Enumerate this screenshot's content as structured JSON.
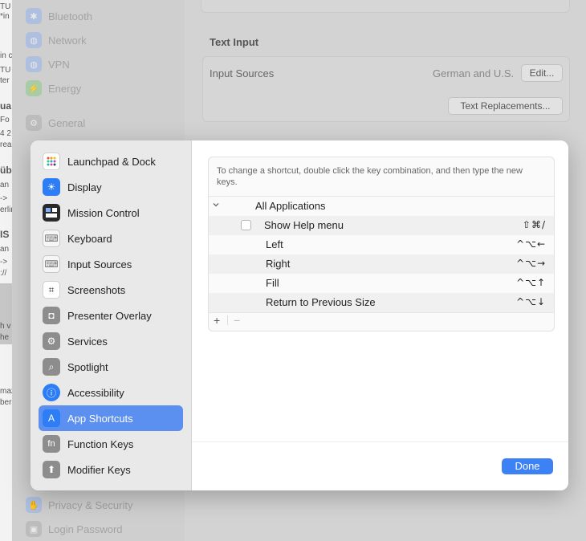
{
  "background": {
    "left_fragments": [
      "TU",
      "*in",
      "in c",
      "TU",
      "ter",
      "ua",
      "Fo",
      "4 2",
      "rea",
      "üb",
      "an",
      "->",
      "erlin",
      "IS",
      "an",
      "->",
      "://",
      "h v",
      "he",
      "maz",
      "bers"
    ],
    "sidebar_items": [
      {
        "label": "Bluetooth",
        "icon": "bluetooth-icon",
        "color": "#8aa7e0"
      },
      {
        "label": "Network",
        "icon": "globe-icon",
        "color": "#8aa7e0"
      },
      {
        "label": "VPN",
        "icon": "globe-icon",
        "color": "#8aa7e0"
      },
      {
        "label": "Energy",
        "icon": "energy-icon",
        "color": "#8cc08a"
      },
      {
        "label": "General",
        "icon": "gear-icon",
        "color": "#aaaaaa"
      },
      {
        "label": "Privacy & Security",
        "icon": "hand-icon",
        "color": "#8aa7e0"
      },
      {
        "label": "Login Password",
        "icon": "lock-icon",
        "color": "#aaaaaa"
      }
    ],
    "text_input_heading": "Text Input",
    "input_sources_label": "Input Sources",
    "input_sources_value": "German and U.S.",
    "edit_button": "Edit...",
    "text_replacements_button": "Text Replacements..."
  },
  "modal": {
    "sidebar": [
      {
        "label": "Launchpad & Dock",
        "icon": "launchpad-icon",
        "selected": false
      },
      {
        "label": "Display",
        "icon": "display-icon",
        "selected": false
      },
      {
        "label": "Mission Control",
        "icon": "mission-control-icon",
        "selected": false
      },
      {
        "label": "Keyboard",
        "icon": "keyboard-icon",
        "selected": false
      },
      {
        "label": "Input Sources",
        "icon": "input-sources-icon",
        "selected": false
      },
      {
        "label": "Screenshots",
        "icon": "screenshot-icon",
        "selected": false
      },
      {
        "label": "Presenter Overlay",
        "icon": "presenter-icon",
        "selected": false
      },
      {
        "label": "Services",
        "icon": "services-icon",
        "selected": false
      },
      {
        "label": "Spotlight",
        "icon": "spotlight-icon",
        "selected": false
      },
      {
        "label": "Accessibility",
        "icon": "accessibility-icon",
        "selected": false
      },
      {
        "label": "App Shortcuts",
        "icon": "app-store-icon",
        "selected": true
      },
      {
        "label": "Function Keys",
        "icon": "fn-icon",
        "selected": false
      },
      {
        "label": "Modifier Keys",
        "icon": "arrow-up-icon",
        "selected": false
      }
    ],
    "instructions": "To change a shortcut, double click the key combination, and then type the new keys.",
    "group_label": "All Applications",
    "shortcuts": [
      {
        "label": "Show Help menu",
        "keys": "⇧⌘/",
        "checkbox": true
      },
      {
        "label": "Left",
        "keys": "^⌥←",
        "checkbox": false
      },
      {
        "label": "Right",
        "keys": "^⌥→",
        "checkbox": false
      },
      {
        "label": "Fill",
        "keys": "^⌥↑",
        "checkbox": false
      },
      {
        "label": "Return to Previous Size",
        "keys": "^⌥↓",
        "checkbox": false
      }
    ],
    "add_symbol": "+",
    "remove_symbol": "−",
    "done_button": "Done",
    "accent_color": "#3d82f5"
  }
}
